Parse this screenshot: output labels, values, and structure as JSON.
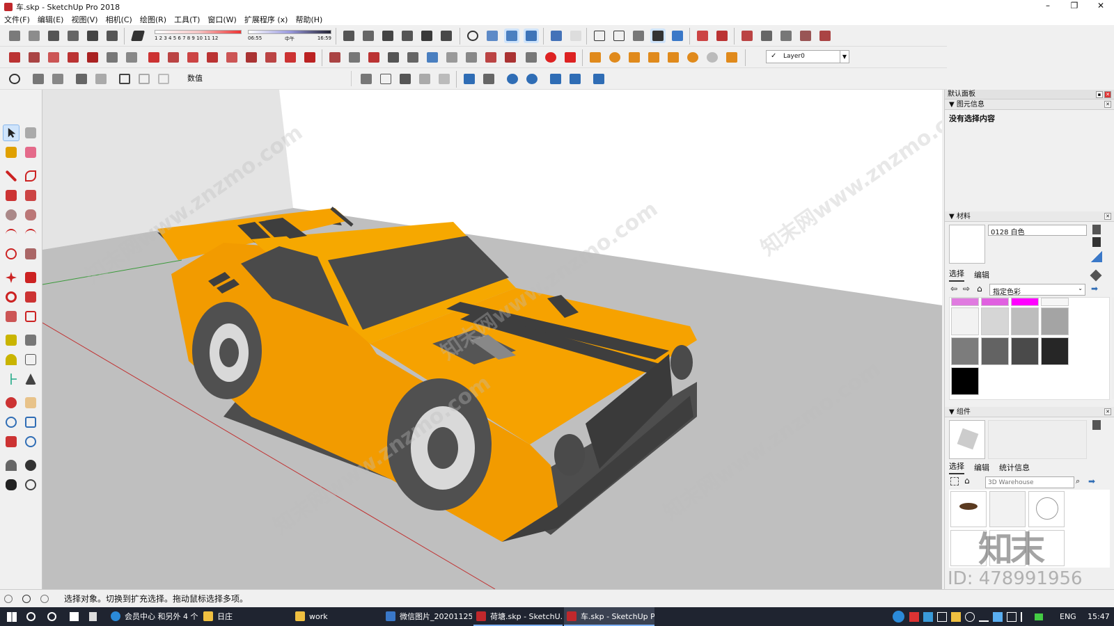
{
  "window": {
    "title": "车.skp - SketchUp Pro 2018",
    "controls": [
      "–",
      "❐",
      "✕"
    ]
  },
  "menu": [
    "文件(F)",
    "编辑(E)",
    "视图(V)",
    "相机(C)",
    "绘图(R)",
    "工具(T)",
    "窗口(W)",
    "扩展程序 (x)",
    "帮助(H)"
  ],
  "toolbar": {
    "shadow_months": "1 2 3 4 5 6 7 8 9 10 11 12",
    "shadow_time_start": "06:55",
    "shadow_time_mid": "中午",
    "shadow_time_end": "16:59",
    "layer_check": "✓",
    "layer": "Layer0",
    "measurements_label": "数值"
  },
  "colors": {
    "accent": "#c0282c",
    "car_body": "#f6a200",
    "car_dark": "#4d4d4d",
    "ground": "#bdbdbd",
    "wall": "#e4e4e4",
    "taskbar": "#1f2430",
    "magenta": "#ff00ff",
    "pink": "#e07be0"
  },
  "tray": {
    "title": "默认面板",
    "entity_info": {
      "header": "图元信息",
      "empty_text": "没有选择内容"
    },
    "materials": {
      "header": "材料",
      "name": "0128 白色",
      "tab_select": "选择",
      "tab_edit": "编辑",
      "collection": "指定色彩"
    },
    "components": {
      "header": "组件",
      "tab_select": "选择",
      "tab_edit": "编辑",
      "tab_stats": "统计信息",
      "search_placeholder": "3D Warehouse"
    },
    "id_text": "ID: 478991956"
  },
  "status": {
    "text": "选择对象。切换到扩充选择。拖动鼠标选择多项。"
  },
  "taskbar": {
    "items": [
      "会员中心 和另外 4 个...",
      "日庄",
      "work",
      "微信图片_20201125...",
      "荷塘.skp - SketchU...",
      "车.skp - SketchUp P..."
    ],
    "lang": "ENG",
    "time": "15:47"
  },
  "watermark": "知末网www.znzmo.com",
  "watermark_logo": "知末"
}
